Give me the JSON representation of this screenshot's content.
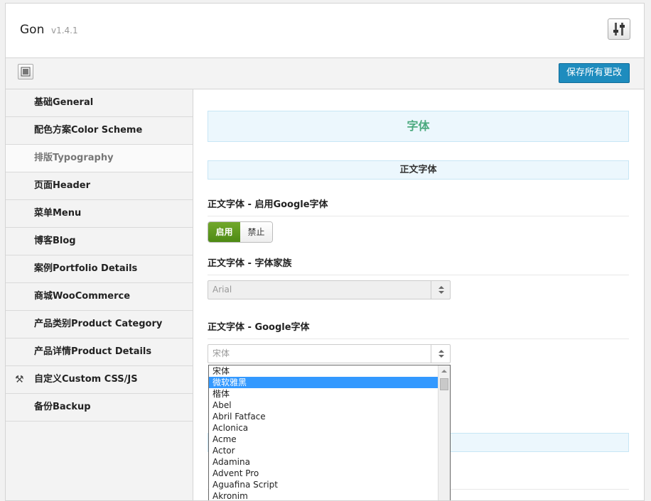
{
  "header": {
    "app_name": "Gon",
    "version": "v1.4.1"
  },
  "toolbar": {
    "save_label": "保存所有更改"
  },
  "sidebar": {
    "items": [
      {
        "label": "基础General",
        "icon": ""
      },
      {
        "label": "配色方案Color Scheme",
        "icon": ""
      },
      {
        "label": "排版Typography",
        "icon": "",
        "active": true
      },
      {
        "label": "页面Header",
        "icon": ""
      },
      {
        "label": "菜单Menu",
        "icon": ""
      },
      {
        "label": "博客Blog",
        "icon": ""
      },
      {
        "label": "案例Portfolio Details",
        "icon": ""
      },
      {
        "label": "商城WooCommerce",
        "icon": ""
      },
      {
        "label": "产品类别Product Category",
        "icon": ""
      },
      {
        "label": "产品详情Product Details",
        "icon": ""
      },
      {
        "label": "自定义Custom CSS/JS",
        "icon": "tools-icon"
      },
      {
        "label": "备份Backup",
        "icon": ""
      }
    ]
  },
  "main": {
    "section_title": "字体",
    "subsection_title": "正文字体",
    "google_toggle_label": "正文字体 - 启用Google字体",
    "toggle_on": "启用",
    "toggle_off": "禁止",
    "family_label": "正文字体 - 字体家族",
    "family_value": "Arial",
    "google_font_label": "正文字体 - Google字体",
    "google_font_value": "宋体"
  },
  "dropdown": {
    "options": [
      "宋体",
      "微软雅黑",
      "楷体",
      "Abel",
      "Abril Fatface",
      "Aclonica",
      "Acme",
      "Actor",
      "Adamina",
      "Advent Pro",
      "Aguafina Script",
      "Akronim"
    ],
    "selected": "微软雅黑"
  },
  "colors": {
    "accent": "#1e8cbe",
    "section_title": "#4aa97e",
    "toggle_on": "#5c9a1e",
    "selection": "#3399ff"
  }
}
